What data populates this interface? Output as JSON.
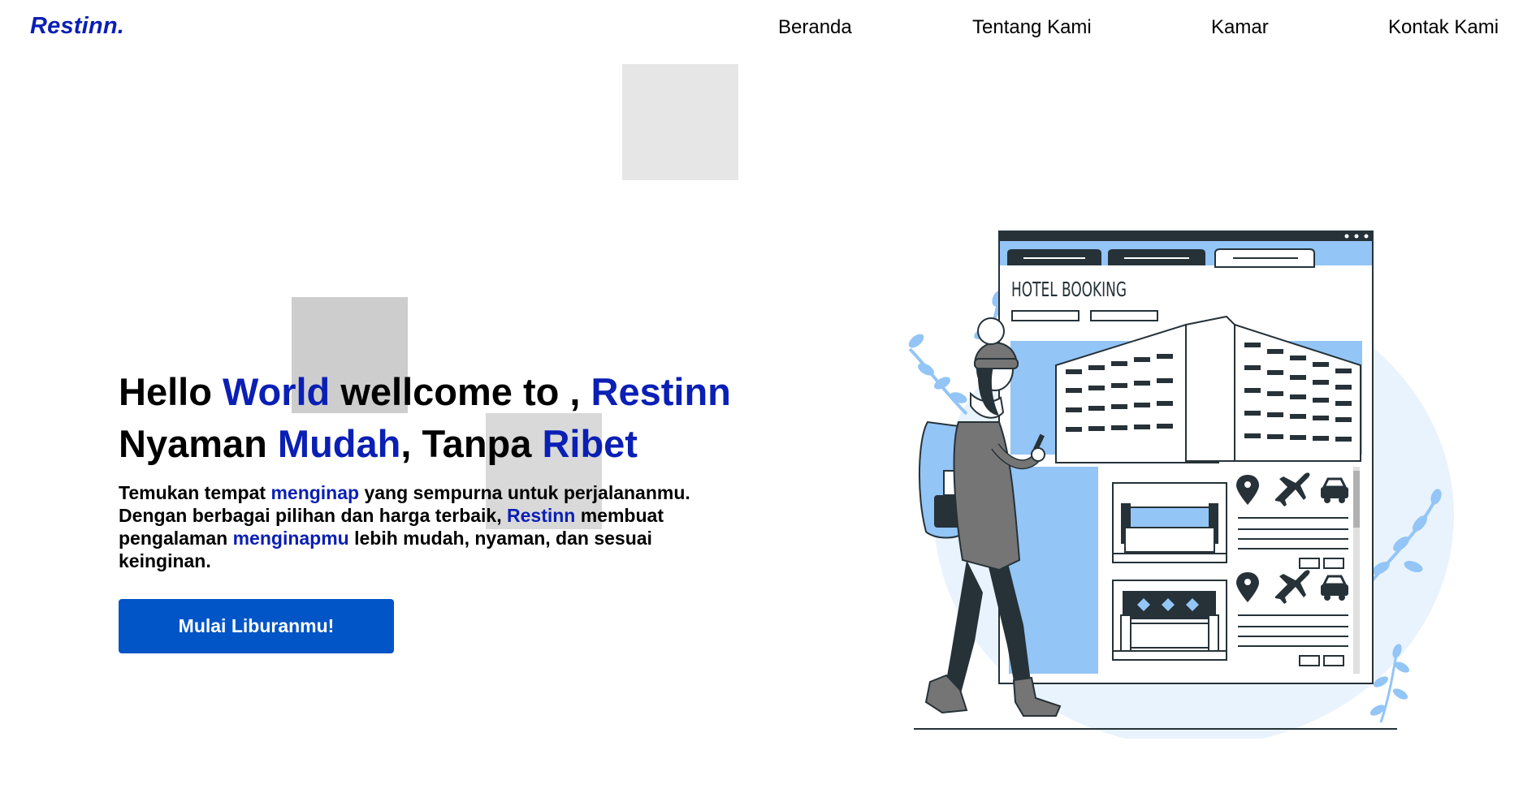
{
  "brand": "Restinn.",
  "nav": [
    "Beranda",
    "Tentang Kami",
    "Kamar",
    "Kontak Kami"
  ],
  "hero": {
    "line1": {
      "w1": "Hello",
      "w2": "World",
      "w3": "wellcome to ,",
      "w4": "Restinn"
    },
    "line2": {
      "w1": "Nyaman",
      "w2": "Mudah",
      "w3": ", Tanpa",
      "w4": "Ribet"
    },
    "desc": {
      "p1": "Temukan tempat",
      "p2": "menginap",
      "p3": "yang sempurna untuk perjalananmu. Dengan berbagai pilihan dan harga terbaik,",
      "p4": "Restinn",
      "p5": "membuat pengalaman",
      "p6": "menginapmu",
      "p7": "lebih mudah, nyaman, dan sesuai keinginan."
    },
    "cta": "Mulai Liburanmu!"
  },
  "illustration": {
    "sign": "HOTEL BOOKING"
  },
  "colors": {
    "brand_blue": "#0a1fb4",
    "button_blue": "#0255c6",
    "light_blue": "#93c5f7",
    "bg_circle": "#e9f3fd",
    "dark": "#263238"
  }
}
